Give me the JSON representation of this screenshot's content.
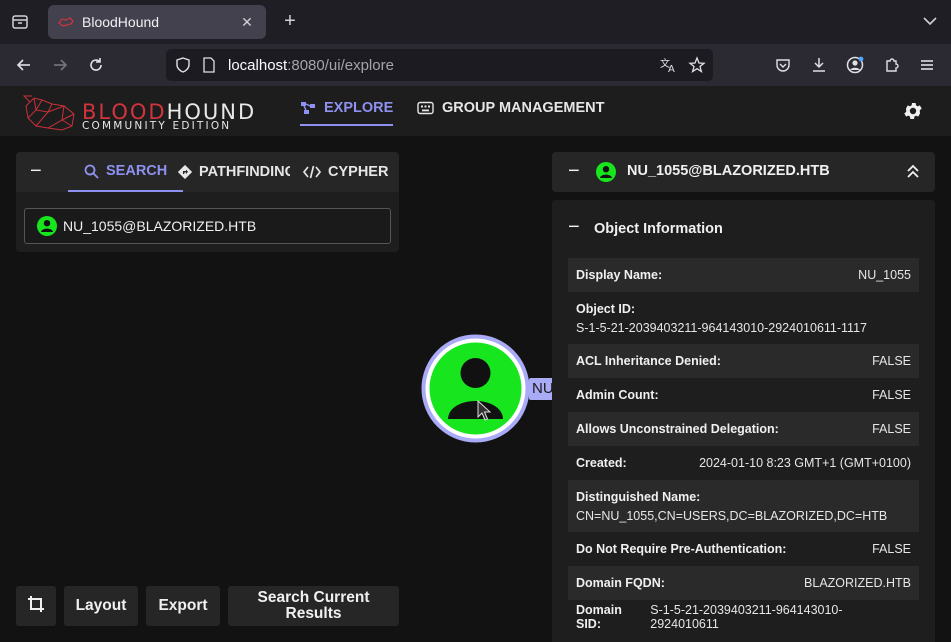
{
  "browser": {
    "tab_title": "BloodHound",
    "url_host": "localhost",
    "url_rest": ":8080/ui/explore"
  },
  "header": {
    "logo_word_red": "BLOOD",
    "logo_word_white": "HOUND",
    "logo_sub": "COMMUNITY EDITION",
    "nav": {
      "explore": "EXPLORE",
      "group_management": "GROUP MANAGEMENT"
    }
  },
  "search": {
    "tabs": {
      "search": "SEARCH",
      "pathfinding": "PATHFINDING",
      "cypher": "CYPHER"
    },
    "value": "NU_1055@BLAZORIZED.HTB"
  },
  "bottom_buttons": {
    "layout": "Layout",
    "export": "Export",
    "search_current_results_line1": "Search Current",
    "search_current_results_line2": "Results"
  },
  "graph": {
    "node_label": "NU"
  },
  "entity": {
    "title": "NU_1055@BLAZORIZED.HTB",
    "section_title": "Object Information",
    "properties": [
      {
        "key": "Display Name:",
        "value": "NU_1055",
        "stack": false
      },
      {
        "key": "Object ID:",
        "value": "S-1-5-21-2039403211-964143010-2924010611-1117",
        "stack": true
      },
      {
        "key": "ACL Inheritance Denied:",
        "value": "FALSE",
        "stack": false
      },
      {
        "key": "Admin Count:",
        "value": "FALSE",
        "stack": false
      },
      {
        "key": "Allows Unconstrained Delegation:",
        "value": "FALSE",
        "stack": false
      },
      {
        "key": "Created:",
        "value": "2024-01-10 8:23 GMT+1 (GMT+0100)",
        "stack": false
      },
      {
        "key": "Distinguished Name:",
        "value": "CN=NU_1055,CN=USERS,DC=BLAZORIZED,DC=HTB",
        "stack": true
      },
      {
        "key": "Do Not Require Pre-Authentication:",
        "value": "FALSE",
        "stack": false
      },
      {
        "key": "Domain FQDN:",
        "value": "BLAZORIZED.HTB",
        "stack": false
      },
      {
        "key": "Domain SID:",
        "value": "S-1-5-21-2039403211-964143010-2924010611",
        "stack": false
      }
    ]
  },
  "colors": {
    "accent": "#8e91f0",
    "user_node": "#17e51d",
    "brand_red": "#d1343d"
  }
}
